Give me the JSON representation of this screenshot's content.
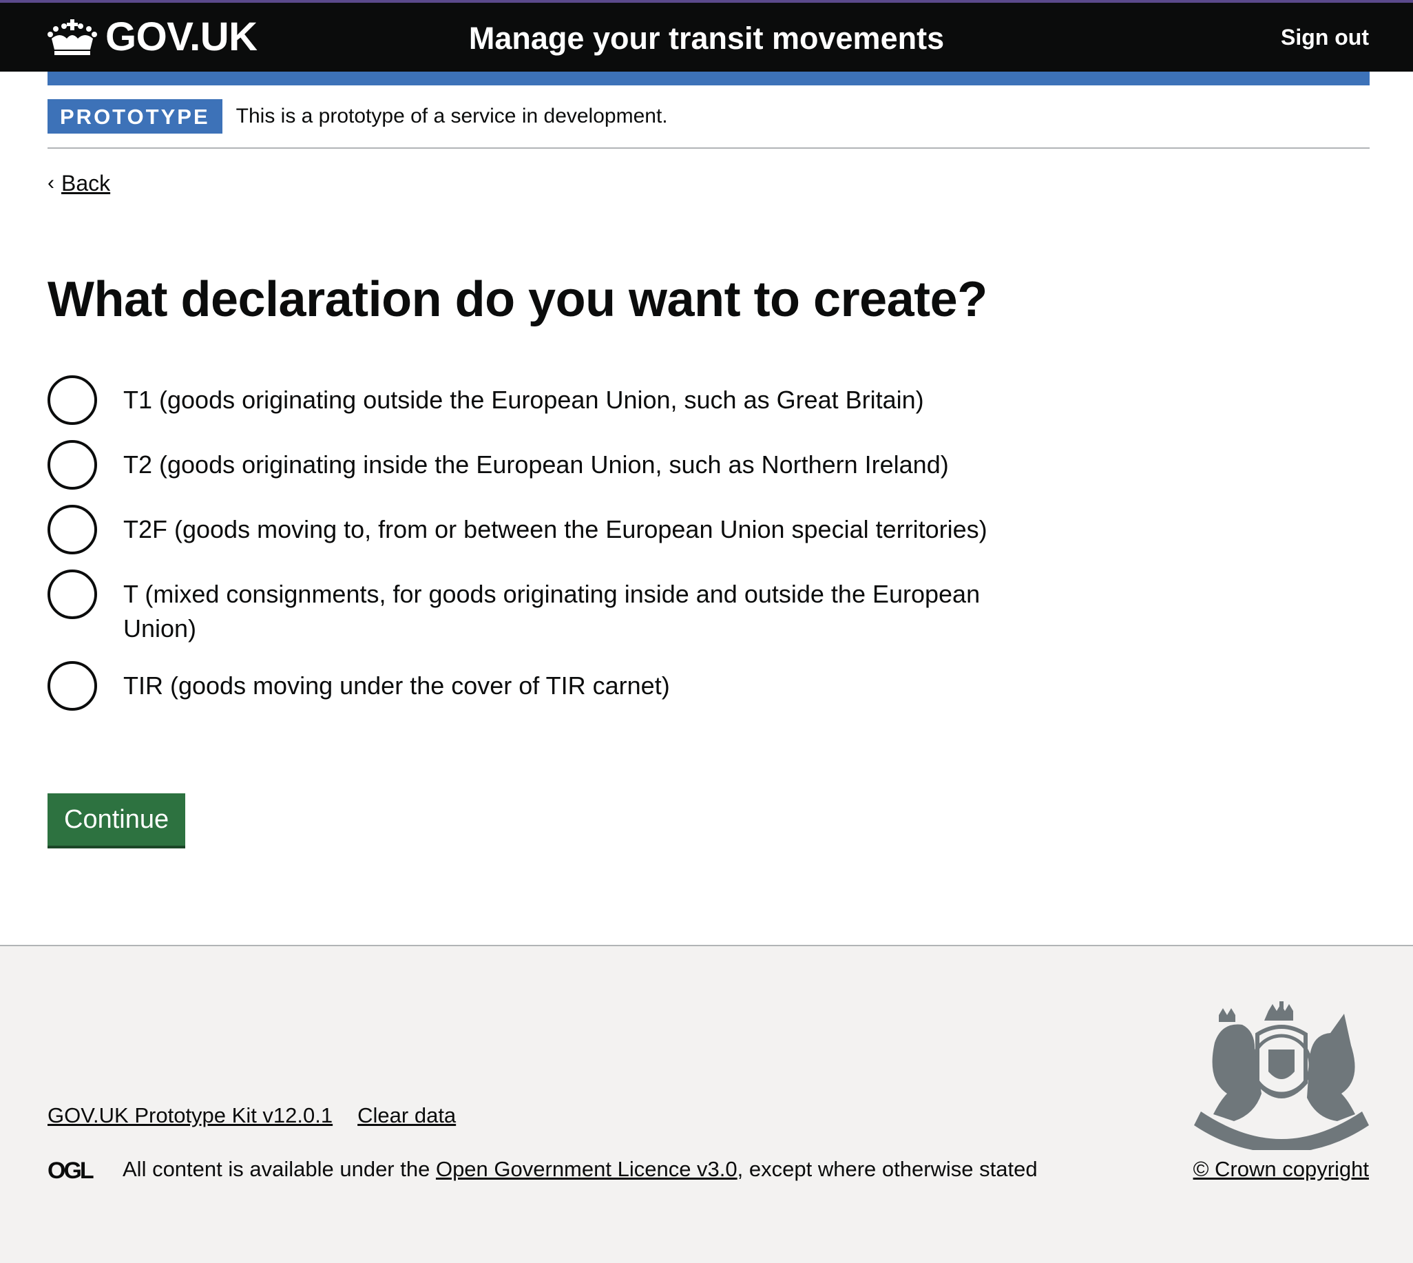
{
  "header": {
    "logo_text": "GOV.UK",
    "service_name": "Manage your transit movements",
    "sign_out_label": "Sign out"
  },
  "phase_banner": {
    "tag": "PROTOTYPE",
    "text": "This is a prototype of a service in development."
  },
  "back_link": {
    "label": "Back"
  },
  "main": {
    "heading": "What declaration do you want to create?",
    "options": [
      {
        "label": "T1 (goods originating outside the European Union, such as Great Britain)",
        "selected": false
      },
      {
        "label": "T2 (goods originating inside the European Union, such as Northern Ireland)",
        "selected": false
      },
      {
        "label": "T2F (goods moving to, from or between the European Union special territories)",
        "selected": false
      },
      {
        "label": "T (mixed consignments, for goods originating inside and outside the European Union)",
        "selected": false
      },
      {
        "label": "TIR (goods moving under the cover of TIR carnet)",
        "selected": false
      }
    ],
    "continue_label": "Continue"
  },
  "footer": {
    "links": [
      "GOV.UK Prototype Kit v12.0.1",
      "Clear data"
    ],
    "ogl_logo": "OGL",
    "licence_prefix": "All content is available under the ",
    "licence_link": "Open Government Licence v3.0",
    "licence_suffix": ", except where otherwise stated",
    "copyright": "© Crown copyright"
  },
  "icons": {
    "crown": "crown-icon",
    "back": "chevron-left-icon",
    "crest": "royal-coat-of-arms-icon"
  },
  "colors": {
    "header_bg": "#0b0c0c",
    "brand_blue": "#3d72b8",
    "button_green": "#2d7240",
    "footer_bg": "#f3f2f1",
    "top_stripe": "#5b4a8c"
  }
}
